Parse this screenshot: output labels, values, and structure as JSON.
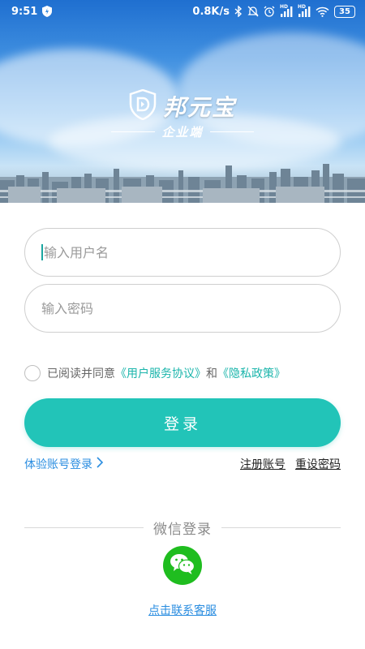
{
  "status_bar": {
    "time": "9:51",
    "network_speed": "0.8K/s",
    "signal_1_label": "HD",
    "signal_2_label": "HD",
    "battery": "35",
    "icons": [
      "shield-icon",
      "bluetooth-icon",
      "mute-icon",
      "alarm-icon",
      "signal-icon",
      "wifi-icon",
      "battery-icon"
    ]
  },
  "brand": {
    "name": "邦元宝",
    "subtitle": "企业端",
    "logo_icon": "shield-logo-icon"
  },
  "form": {
    "username_placeholder": "输入用户名",
    "password_placeholder": "输入密码",
    "username_value": "",
    "password_value": ""
  },
  "agreement": {
    "prefix": "已阅读并同意",
    "user_agreement": "《用户服务协议》",
    "and": "和",
    "privacy_policy": "《隐私政策》",
    "checked": false
  },
  "login_button": "登录",
  "links": {
    "trial_login": "体验账号登录",
    "register": "注册账号",
    "reset_password": "重设密码"
  },
  "wechat": {
    "label": "微信登录",
    "icon": "wechat-icon"
  },
  "contact": "点击联系客服",
  "colors": {
    "accent": "#22c4b8",
    "link_blue": "#2a8de0",
    "link_teal": "#1ab5ab",
    "wechat_green": "#1fbd1f"
  }
}
